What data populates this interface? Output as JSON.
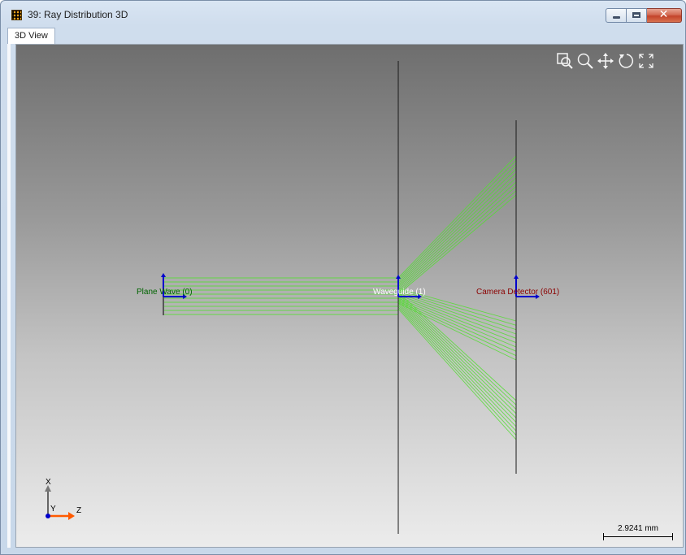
{
  "window": {
    "title": "39: Ray Distribution 3D",
    "controls": {
      "minimize": "minimize",
      "maximize": "maximize",
      "close": "✕"
    }
  },
  "tabs": [
    {
      "label": "3D View",
      "active": true
    }
  ],
  "viewer": {
    "toolbar": [
      {
        "name": "zoom-window-icon",
        "tooltip": ""
      },
      {
        "name": "zoom-icon",
        "tooltip": ""
      },
      {
        "name": "pan-icon",
        "tooltip": ""
      },
      {
        "name": "rotate-icon",
        "tooltip": ""
      },
      {
        "name": "fit-view-icon",
        "tooltip": ""
      }
    ],
    "components": [
      {
        "label": "Plane Wave (0)",
        "color": "#006400"
      },
      {
        "label": "Waveguide (1)",
        "color": "#ffffff"
      },
      {
        "label": "Camera Detector (601)",
        "color": "#8b0000"
      }
    ],
    "ray_color": "#55dd33",
    "axis_triad": {
      "x_label": "X",
      "y_label": "Y",
      "z_label": "Z"
    },
    "scale_bar": {
      "label": "2.9241 mm"
    }
  }
}
